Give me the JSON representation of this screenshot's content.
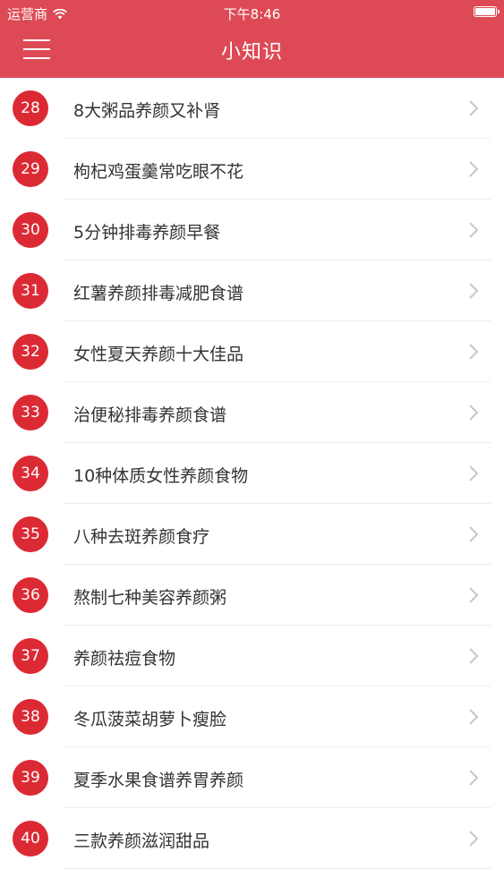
{
  "status_bar": {
    "carrier": "运营商",
    "time": "下午8:46"
  },
  "nav": {
    "title": "小知识"
  },
  "items": [
    {
      "number": "28",
      "title": "8大粥品养颜又补肾"
    },
    {
      "number": "29",
      "title": "枸杞鸡蛋羹常吃眼不花"
    },
    {
      "number": "30",
      "title": "5分钟排毒养颜早餐"
    },
    {
      "number": "31",
      "title": "红薯养颜排毒减肥食谱"
    },
    {
      "number": "32",
      "title": "女性夏天养颜十大佳品"
    },
    {
      "number": "33",
      "title": "治便秘排毒养颜食谱"
    },
    {
      "number": "34",
      "title": "10种体质女性养颜食物"
    },
    {
      "number": "35",
      "title": "八种去斑养颜食疗"
    },
    {
      "number": "36",
      "title": "熬制七种美容养颜粥"
    },
    {
      "number": "37",
      "title": "养颜祛痘食物"
    },
    {
      "number": "38",
      "title": "冬瓜菠菜胡萝卜瘦脸"
    },
    {
      "number": "39",
      "title": "夏季水果食谱养胃养颜"
    },
    {
      "number": "40",
      "title": "三款养颜滋润甜品"
    }
  ],
  "colors": {
    "header": "#dd4a55",
    "badge": "#dc2a35",
    "text": "#333333",
    "chevron": "#c7c7cc"
  }
}
